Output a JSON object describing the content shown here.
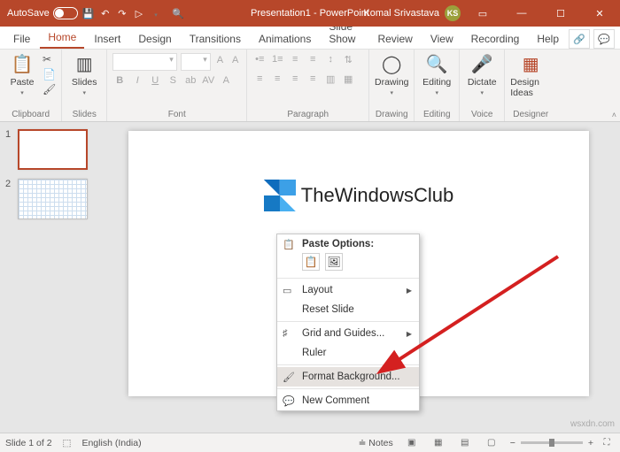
{
  "titlebar": {
    "autosave_label": "AutoSave",
    "autosave_state": "Off",
    "doc_title": "Presentation1 - PowerPoint",
    "user_name": "Komal Srivastava",
    "user_initials": "KS"
  },
  "tabs": {
    "file": "File",
    "home": "Home",
    "insert": "Insert",
    "design": "Design",
    "transitions": "Transitions",
    "animations": "Animations",
    "slideshow": "Slide Show",
    "review": "Review",
    "view": "View",
    "recording": "Recording",
    "help": "Help"
  },
  "ribbon": {
    "clipboard": {
      "paste": "Paste",
      "label": "Clipboard"
    },
    "slides": {
      "slides": "Slides",
      "label": "Slides"
    },
    "font": {
      "label": "Font"
    },
    "paragraph": {
      "label": "Paragraph"
    },
    "drawing": {
      "btn": "Drawing",
      "label": "Drawing"
    },
    "editing": {
      "btn": "Editing",
      "label": "Editing"
    },
    "voice": {
      "btn": "Dictate",
      "label": "Voice"
    },
    "designer": {
      "btn": "Design Ideas",
      "label": "Designer"
    }
  },
  "thumbs": {
    "n1": "1",
    "n2": "2"
  },
  "slide": {
    "brand": "TheWindowsClub"
  },
  "context_menu": {
    "paste_options": "Paste Options:",
    "layout": "Layout",
    "reset_slide": "Reset Slide",
    "grid_guides": "Grid and Guides...",
    "ruler": "Ruler",
    "format_bg": "Format Background...",
    "new_comment": "New Comment"
  },
  "statusbar": {
    "slide_pos": "Slide 1 of 2",
    "language": "English (India)",
    "notes": "Notes",
    "zoom_minus": "−",
    "zoom_plus": "+"
  },
  "watermark": "wsxdn.com"
}
